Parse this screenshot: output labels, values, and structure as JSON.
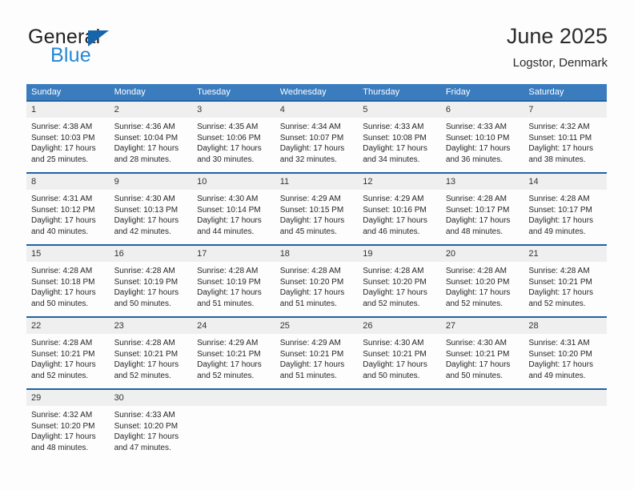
{
  "brand": {
    "name_top": "General",
    "name_bottom": "Blue",
    "accent_color": "#2487d4",
    "triangle_color": "#1565ac"
  },
  "header": {
    "title": "June 2025",
    "location": "Logstor, Denmark"
  },
  "theme": {
    "header_bg": "#3a7cbe",
    "row_border": "#1f63a6",
    "daynum_bg": "#efefef",
    "page_bg": "#fdfdfd"
  },
  "weekday_headers": [
    "Sunday",
    "Monday",
    "Tuesday",
    "Wednesday",
    "Thursday",
    "Friday",
    "Saturday"
  ],
  "labels": {
    "sunrise_prefix": "Sunrise:",
    "sunset_prefix": "Sunset:",
    "daylight_prefix": "Daylight:"
  },
  "weeks": [
    [
      {
        "day": "1",
        "line1": "Sunrise: 4:38 AM",
        "line2": "Sunset: 10:03 PM",
        "line3": "Daylight: 17 hours",
        "line4": "and 25 minutes."
      },
      {
        "day": "2",
        "line1": "Sunrise: 4:36 AM",
        "line2": "Sunset: 10:04 PM",
        "line3": "Daylight: 17 hours",
        "line4": "and 28 minutes."
      },
      {
        "day": "3",
        "line1": "Sunrise: 4:35 AM",
        "line2": "Sunset: 10:06 PM",
        "line3": "Daylight: 17 hours",
        "line4": "and 30 minutes."
      },
      {
        "day": "4",
        "line1": "Sunrise: 4:34 AM",
        "line2": "Sunset: 10:07 PM",
        "line3": "Daylight: 17 hours",
        "line4": "and 32 minutes."
      },
      {
        "day": "5",
        "line1": "Sunrise: 4:33 AM",
        "line2": "Sunset: 10:08 PM",
        "line3": "Daylight: 17 hours",
        "line4": "and 34 minutes."
      },
      {
        "day": "6",
        "line1": "Sunrise: 4:33 AM",
        "line2": "Sunset: 10:10 PM",
        "line3": "Daylight: 17 hours",
        "line4": "and 36 minutes."
      },
      {
        "day": "7",
        "line1": "Sunrise: 4:32 AM",
        "line2": "Sunset: 10:11 PM",
        "line3": "Daylight: 17 hours",
        "line4": "and 38 minutes."
      }
    ],
    [
      {
        "day": "8",
        "line1": "Sunrise: 4:31 AM",
        "line2": "Sunset: 10:12 PM",
        "line3": "Daylight: 17 hours",
        "line4": "and 40 minutes."
      },
      {
        "day": "9",
        "line1": "Sunrise: 4:30 AM",
        "line2": "Sunset: 10:13 PM",
        "line3": "Daylight: 17 hours",
        "line4": "and 42 minutes."
      },
      {
        "day": "10",
        "line1": "Sunrise: 4:30 AM",
        "line2": "Sunset: 10:14 PM",
        "line3": "Daylight: 17 hours",
        "line4": "and 44 minutes."
      },
      {
        "day": "11",
        "line1": "Sunrise: 4:29 AM",
        "line2": "Sunset: 10:15 PM",
        "line3": "Daylight: 17 hours",
        "line4": "and 45 minutes."
      },
      {
        "day": "12",
        "line1": "Sunrise: 4:29 AM",
        "line2": "Sunset: 10:16 PM",
        "line3": "Daylight: 17 hours",
        "line4": "and 46 minutes."
      },
      {
        "day": "13",
        "line1": "Sunrise: 4:28 AM",
        "line2": "Sunset: 10:17 PM",
        "line3": "Daylight: 17 hours",
        "line4": "and 48 minutes."
      },
      {
        "day": "14",
        "line1": "Sunrise: 4:28 AM",
        "line2": "Sunset: 10:17 PM",
        "line3": "Daylight: 17 hours",
        "line4": "and 49 minutes."
      }
    ],
    [
      {
        "day": "15",
        "line1": "Sunrise: 4:28 AM",
        "line2": "Sunset: 10:18 PM",
        "line3": "Daylight: 17 hours",
        "line4": "and 50 minutes."
      },
      {
        "day": "16",
        "line1": "Sunrise: 4:28 AM",
        "line2": "Sunset: 10:19 PM",
        "line3": "Daylight: 17 hours",
        "line4": "and 50 minutes."
      },
      {
        "day": "17",
        "line1": "Sunrise: 4:28 AM",
        "line2": "Sunset: 10:19 PM",
        "line3": "Daylight: 17 hours",
        "line4": "and 51 minutes."
      },
      {
        "day": "18",
        "line1": "Sunrise: 4:28 AM",
        "line2": "Sunset: 10:20 PM",
        "line3": "Daylight: 17 hours",
        "line4": "and 51 minutes."
      },
      {
        "day": "19",
        "line1": "Sunrise: 4:28 AM",
        "line2": "Sunset: 10:20 PM",
        "line3": "Daylight: 17 hours",
        "line4": "and 52 minutes."
      },
      {
        "day": "20",
        "line1": "Sunrise: 4:28 AM",
        "line2": "Sunset: 10:20 PM",
        "line3": "Daylight: 17 hours",
        "line4": "and 52 minutes."
      },
      {
        "day": "21",
        "line1": "Sunrise: 4:28 AM",
        "line2": "Sunset: 10:21 PM",
        "line3": "Daylight: 17 hours",
        "line4": "and 52 minutes."
      }
    ],
    [
      {
        "day": "22",
        "line1": "Sunrise: 4:28 AM",
        "line2": "Sunset: 10:21 PM",
        "line3": "Daylight: 17 hours",
        "line4": "and 52 minutes."
      },
      {
        "day": "23",
        "line1": "Sunrise: 4:28 AM",
        "line2": "Sunset: 10:21 PM",
        "line3": "Daylight: 17 hours",
        "line4": "and 52 minutes."
      },
      {
        "day": "24",
        "line1": "Sunrise: 4:29 AM",
        "line2": "Sunset: 10:21 PM",
        "line3": "Daylight: 17 hours",
        "line4": "and 52 minutes."
      },
      {
        "day": "25",
        "line1": "Sunrise: 4:29 AM",
        "line2": "Sunset: 10:21 PM",
        "line3": "Daylight: 17 hours",
        "line4": "and 51 minutes."
      },
      {
        "day": "26",
        "line1": "Sunrise: 4:30 AM",
        "line2": "Sunset: 10:21 PM",
        "line3": "Daylight: 17 hours",
        "line4": "and 50 minutes."
      },
      {
        "day": "27",
        "line1": "Sunrise: 4:30 AM",
        "line2": "Sunset: 10:21 PM",
        "line3": "Daylight: 17 hours",
        "line4": "and 50 minutes."
      },
      {
        "day": "28",
        "line1": "Sunrise: 4:31 AM",
        "line2": "Sunset: 10:20 PM",
        "line3": "Daylight: 17 hours",
        "line4": "and 49 minutes."
      }
    ],
    [
      {
        "day": "29",
        "line1": "Sunrise: 4:32 AM",
        "line2": "Sunset: 10:20 PM",
        "line3": "Daylight: 17 hours",
        "line4": "and 48 minutes."
      },
      {
        "day": "30",
        "line1": "Sunrise: 4:33 AM",
        "line2": "Sunset: 10:20 PM",
        "line3": "Daylight: 17 hours",
        "line4": "and 47 minutes."
      },
      {
        "day": "",
        "line1": "",
        "line2": "",
        "line3": "",
        "line4": ""
      },
      {
        "day": "",
        "line1": "",
        "line2": "",
        "line3": "",
        "line4": ""
      },
      {
        "day": "",
        "line1": "",
        "line2": "",
        "line3": "",
        "line4": ""
      },
      {
        "day": "",
        "line1": "",
        "line2": "",
        "line3": "",
        "line4": ""
      },
      {
        "day": "",
        "line1": "",
        "line2": "",
        "line3": "",
        "line4": ""
      }
    ]
  ]
}
